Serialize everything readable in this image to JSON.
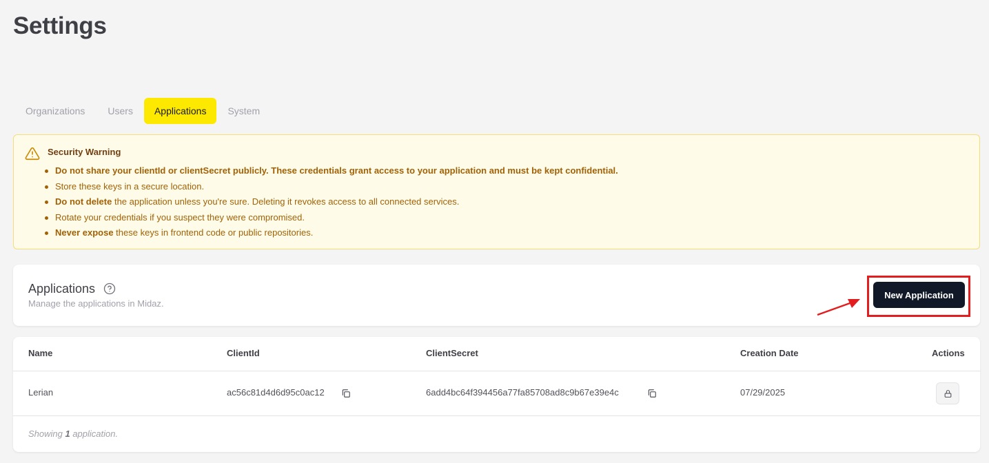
{
  "page": {
    "title": "Settings"
  },
  "tabs": [
    {
      "label": "Organizations",
      "active": false
    },
    {
      "label": "Users",
      "active": false
    },
    {
      "label": "Applications",
      "active": true
    },
    {
      "label": "System",
      "active": false
    }
  ],
  "warning": {
    "title": "Security Warning",
    "items": [
      {
        "bold": "Do not share your clientId or clientSecret publicly. These credentials grant access to your application and must be kept confidential.",
        "text": ""
      },
      {
        "bold": "",
        "text": "Store these keys in a secure location."
      },
      {
        "bold": "Do not delete",
        "text": " the application unless you're sure. Deleting it revokes access to all connected services."
      },
      {
        "bold": "",
        "text": "Rotate your credentials if you suspect they were compromised."
      },
      {
        "bold": "Never expose",
        "text": " these keys in frontend code or public repositories."
      }
    ]
  },
  "applications": {
    "title": "Applications",
    "subtitle": "Manage the applications in Midaz.",
    "new_button_label": "New Application"
  },
  "table": {
    "headers": {
      "name": "Name",
      "client_id": "ClientId",
      "client_secret": "ClientSecret",
      "creation_date": "Creation Date",
      "actions": "Actions"
    },
    "rows": [
      {
        "name": "Lerian",
        "client_id": "ac56c81d4d6d95c0ac12",
        "client_secret": "6add4bc64f394456a77fa85708ad8c9b67e39e4c",
        "creation_date": "07/29/2025"
      }
    ],
    "footer": {
      "prefix": "Showing ",
      "count": "1",
      "suffix": " application."
    }
  },
  "colors": {
    "accent": "#fde800",
    "primary_button": "#111827",
    "warning_bg": "#fefbe8",
    "highlight": "#e11d1d"
  },
  "icons": {
    "warning": "warning-triangle-icon",
    "help": "help-circle-icon",
    "copy": "copy-icon",
    "lock": "lock-icon",
    "arrow": "arrow-annotation-icon"
  }
}
